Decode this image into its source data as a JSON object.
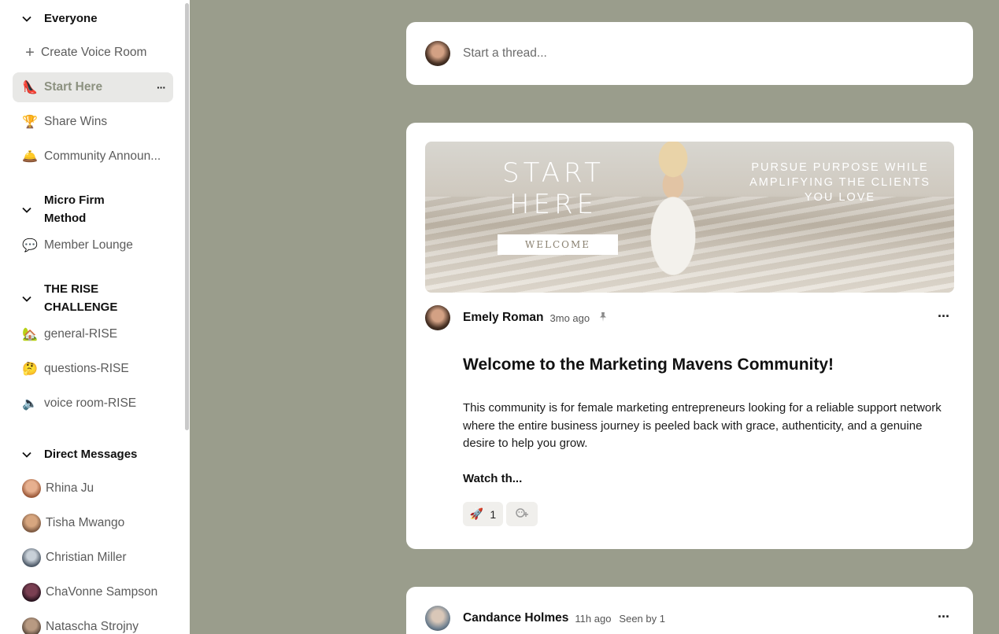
{
  "sidebar": {
    "sections": [
      {
        "title": "Everyone"
      },
      {
        "title": "Micro Firm Method"
      },
      {
        "title": "THE RISE CHALLENGE"
      },
      {
        "title": "Direct Messages"
      }
    ],
    "create_voice_room": "Create Voice Room",
    "channels": [
      {
        "emoji": "👠",
        "label": "Start Here",
        "active": true,
        "more": "···"
      },
      {
        "emoji": "🏆",
        "label": "Share Wins"
      },
      {
        "emoji": "🛎️",
        "label": "Community Announ..."
      },
      {
        "emoji": "💬",
        "label": "Member Lounge"
      },
      {
        "emoji": "🏡",
        "label": "general-RISE"
      },
      {
        "emoji": "🤔",
        "label": "questions-RISE"
      },
      {
        "emoji": "🔈",
        "label": "voice room-RISE"
      }
    ],
    "direct_messages": [
      {
        "name": "Rhina Ju"
      },
      {
        "name": "Tisha Mwango"
      },
      {
        "name": "Christian Miller"
      },
      {
        "name": "ChaVonne Sampson"
      },
      {
        "name": "Natascha Strojny"
      }
    ]
  },
  "composer": {
    "placeholder": "Start a thread..."
  },
  "post": {
    "banner": {
      "title": "START HERE",
      "button": "WELCOME",
      "tagline": "PURSUE PURPOSE WHILE AMPLIFYING THE CLIENTS YOU LOVE"
    },
    "author": "Emely Roman",
    "time": "3mo ago",
    "pin_icon": "📌",
    "more": "···",
    "title": "Welcome to the Marketing Mavens Community!",
    "body": "This community is for female marketing entrepreneurs looking for a reliable support network where the entire business journey is peeled back with grace, authenticity, and a genuine desire to help you grow.",
    "read_more": "Watch th...",
    "reactions": [
      {
        "emoji": "🚀",
        "count": "1"
      }
    ],
    "add_reaction_icon": "add-reaction-icon"
  },
  "post2": {
    "author": "Candance Holmes",
    "time": "11h ago",
    "seen": "Seen by 1",
    "more": "···"
  }
}
